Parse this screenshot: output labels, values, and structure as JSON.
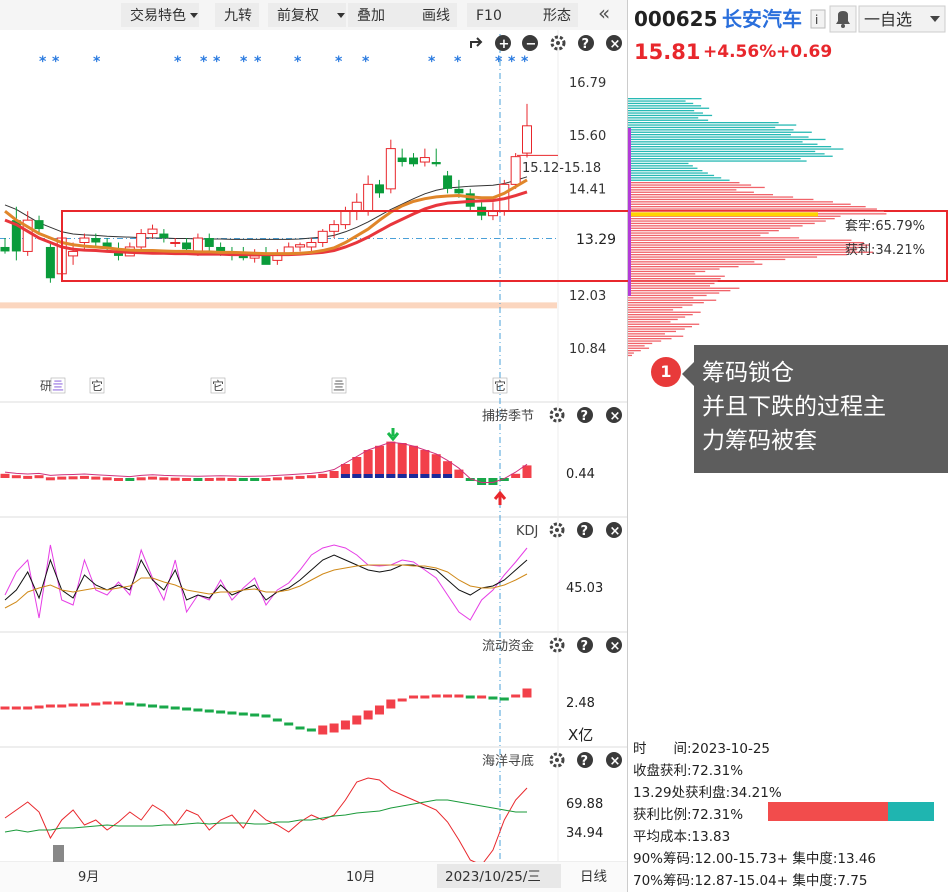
{
  "toolbar": {
    "items": [
      "交易特色",
      "九转",
      "前复权",
      "叠加",
      "画线",
      "F10",
      "形态"
    ],
    "collapse_glyph": "«"
  },
  "stock": {
    "code": "000625",
    "name": "长安汽车",
    "info_glyph": "i",
    "price": "15.81",
    "change_pct": "+4.56%",
    "change_abs": "+0.69",
    "watch_label": "一自选",
    "up_color": "#e8272c",
    "down_color": "#0a9b3a"
  },
  "main_chart": {
    "y_labels": [
      "16.79",
      "15.60",
      "14.41",
      "13.29",
      "12.03",
      "10.84"
    ],
    "highlighted_price": "13.29",
    "range_label": "15.12-15.18",
    "event_markers": [
      "研",
      "亖",
      "它",
      "它",
      "亖",
      "它"
    ],
    "controls": [
      "reset",
      "zoom-in",
      "zoom-out",
      "settings",
      "help",
      "close"
    ],
    "trapped_label": "套牢:65.79%",
    "profit_label": "获利:34.21%"
  },
  "indicators": [
    {
      "name": "捕捞季节",
      "value": "0.44"
    },
    {
      "name": "KDJ",
      "value": "45.03"
    },
    {
      "name": "流动资金",
      "value": "2.48",
      "unit": "X亿"
    },
    {
      "name": "海洋寻底",
      "value": "69.88",
      "value2": "34.94"
    }
  ],
  "x_axis": {
    "labels": [
      "9月",
      "10月"
    ],
    "cursor_date": "2023/10/25/三",
    "period": "日线"
  },
  "chip_info": {
    "time": "时　　间:2023-10-25",
    "close_profit": "收盘获利:72.31%",
    "price_profit": "13.29处获利盘:34.21%",
    "profit_ratio": "获利比例:72.31%",
    "profit_ratio_value": 72.31,
    "avg_cost": "平均成本:13.83",
    "chip90": "90%筹码:12.00-15.73+ 集中度:13.46",
    "chip70": "70%筹码:12.87-15.04+ 集中度:7.75"
  },
  "callout": {
    "badge": "1",
    "lines": [
      "筹码锁仓",
      "并且下跌的过程主",
      "力筹码被套"
    ]
  },
  "chart_data": {
    "type": "candlestick",
    "symbol": "000625",
    "ylim": [
      10.5,
      17.0
    ],
    "last_close": 15.81,
    "candles": [
      {
        "o": 13.1,
        "h": 13.3,
        "l": 12.95,
        "c": 13.0
      },
      {
        "o": 13.7,
        "h": 14.0,
        "l": 12.8,
        "c": 13.0
      },
      {
        "o": 13.0,
        "h": 13.9,
        "l": 12.9,
        "c": 13.7
      },
      {
        "o": 13.7,
        "h": 13.8,
        "l": 13.4,
        "c": 13.5
      },
      {
        "o": 13.1,
        "h": 13.2,
        "l": 12.3,
        "c": 12.4
      },
      {
        "o": 12.5,
        "h": 13.5,
        "l": 12.4,
        "c": 13.3
      },
      {
        "o": 12.9,
        "h": 13.2,
        "l": 12.7,
        "c": 13.0
      },
      {
        "o": 13.2,
        "h": 13.4,
        "l": 13.0,
        "c": 13.3
      },
      {
        "o": 13.3,
        "h": 13.4,
        "l": 13.1,
        "c": 13.2
      },
      {
        "o": 13.2,
        "h": 13.3,
        "l": 13.0,
        "c": 13.1
      },
      {
        "o": 13.0,
        "h": 13.2,
        "l": 12.8,
        "c": 12.9
      },
      {
        "o": 12.9,
        "h": 13.2,
        "l": 12.9,
        "c": 13.1
      },
      {
        "o": 13.1,
        "h": 13.5,
        "l": 13.0,
        "c": 13.4
      },
      {
        "o": 13.4,
        "h": 13.6,
        "l": 13.3,
        "c": 13.5
      },
      {
        "o": 13.4,
        "h": 13.5,
        "l": 13.2,
        "c": 13.3
      },
      {
        "o": 13.2,
        "h": 13.3,
        "l": 13.1,
        "c": 13.2
      },
      {
        "o": 13.2,
        "h": 13.3,
        "l": 13.0,
        "c": 13.05
      },
      {
        "o": 13.0,
        "h": 13.4,
        "l": 12.9,
        "c": 13.3
      },
      {
        "o": 13.3,
        "h": 13.4,
        "l": 13.0,
        "c": 13.1
      },
      {
        "o": 13.1,
        "h": 13.2,
        "l": 12.9,
        "c": 13.0
      },
      {
        "o": 13.0,
        "h": 13.1,
        "l": 12.8,
        "c": 12.95
      },
      {
        "o": 12.95,
        "h": 13.1,
        "l": 12.8,
        "c": 12.85
      },
      {
        "o": 12.85,
        "h": 13.05,
        "l": 12.75,
        "c": 12.9
      },
      {
        "o": 12.9,
        "h": 13.1,
        "l": 12.8,
        "c": 12.7
      },
      {
        "o": 12.8,
        "h": 13.05,
        "l": 12.7,
        "c": 12.95
      },
      {
        "o": 12.95,
        "h": 13.2,
        "l": 12.9,
        "c": 13.1
      },
      {
        "o": 13.1,
        "h": 13.2,
        "l": 13.0,
        "c": 13.15
      },
      {
        "o": 13.1,
        "h": 13.3,
        "l": 13.0,
        "c": 13.2
      },
      {
        "o": 13.2,
        "h": 13.5,
        "l": 13.1,
        "c": 13.45
      },
      {
        "o": 13.45,
        "h": 13.7,
        "l": 13.3,
        "c": 13.6
      },
      {
        "o": 13.6,
        "h": 14.0,
        "l": 13.5,
        "c": 13.9
      },
      {
        "o": 13.9,
        "h": 14.3,
        "l": 13.7,
        "c": 14.1
      },
      {
        "o": 13.9,
        "h": 14.7,
        "l": 13.8,
        "c": 14.5
      },
      {
        "o": 14.5,
        "h": 14.6,
        "l": 14.2,
        "c": 14.3
      },
      {
        "o": 14.4,
        "h": 15.5,
        "l": 14.3,
        "c": 15.3
      },
      {
        "o": 15.1,
        "h": 15.3,
        "l": 14.9,
        "c": 15.0
      },
      {
        "o": 15.1,
        "h": 15.2,
        "l": 14.9,
        "c": 14.95
      },
      {
        "o": 15.0,
        "h": 15.3,
        "l": 14.9,
        "c": 15.1
      },
      {
        "o": 15.0,
        "h": 15.3,
        "l": 14.9,
        "c": 14.95
      },
      {
        "o": 14.7,
        "h": 14.8,
        "l": 14.3,
        "c": 14.4
      },
      {
        "o": 14.4,
        "h": 14.6,
        "l": 14.2,
        "c": 14.3
      },
      {
        "o": 14.3,
        "h": 14.4,
        "l": 13.9,
        "c": 14.0
      },
      {
        "o": 14.0,
        "h": 14.1,
        "l": 13.7,
        "c": 13.8
      },
      {
        "o": 13.8,
        "h": 14.1,
        "l": 13.7,
        "c": 13.9
      },
      {
        "o": 13.9,
        "h": 14.6,
        "l": 13.8,
        "c": 14.5
      },
      {
        "o": 14.5,
        "h": 15.2,
        "l": 14.4,
        "c": 15.12
      },
      {
        "o": 15.2,
        "h": 16.3,
        "l": 15.1,
        "c": 15.81
      }
    ],
    "ma_fast": [
      13.9,
      13.7,
      13.55,
      13.4,
      13.3,
      13.2,
      13.15,
      13.12,
      13.1,
      13.08,
      13.05,
      13.03,
      13.02,
      13.02,
      13.01,
      13.0,
      13.0,
      12.99,
      12.99,
      12.98,
      12.98,
      12.97,
      12.96,
      12.95,
      12.95,
      12.95,
      12.96,
      12.98,
      13.02,
      13.08,
      13.2,
      13.35,
      13.5,
      13.7,
      13.88,
      14.02,
      14.12,
      14.18,
      14.22,
      14.24,
      14.25,
      14.22,
      14.2,
      14.2,
      14.3,
      14.45,
      14.6
    ],
    "ma_slow": [
      13.7,
      13.6,
      13.45,
      13.3,
      13.2,
      13.1,
      13.05,
      13.03,
      13.02,
      13.0,
      12.99,
      12.98,
      12.97,
      12.96,
      12.96,
      12.95,
      12.95,
      12.94,
      12.94,
      12.94,
      12.93,
      12.93,
      12.93,
      12.93,
      12.93,
      12.93,
      12.94,
      12.96,
      12.98,
      13.02,
      13.1,
      13.2,
      13.32,
      13.46,
      13.6,
      13.72,
      13.84,
      13.95,
      14.03,
      14.08,
      14.1,
      14.12,
      14.13,
      14.14,
      14.18,
      14.25,
      14.33
    ]
  }
}
